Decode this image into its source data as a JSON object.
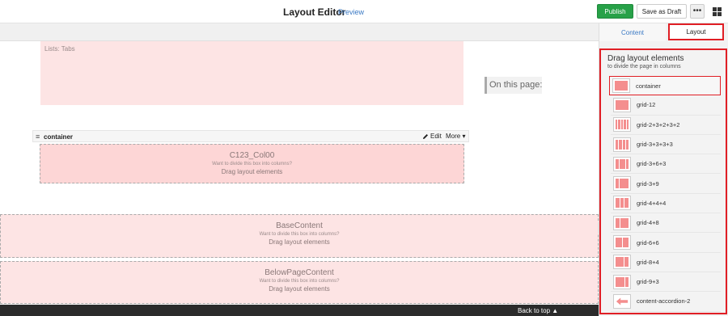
{
  "header": {
    "title": "Layout Editor",
    "preview_label": "Preview",
    "publish_label": "Publish",
    "save_draft_label": "Save as Draft",
    "more_label": "•••"
  },
  "canvas": {
    "lists_tabs_label": "Lists: Tabs",
    "on_this_page": "On this page:",
    "container": {
      "label": "container",
      "edit_label": "Edit",
      "more_label": "More ▾"
    },
    "dropzones": {
      "col00": {
        "title": "C123_Col00",
        "hint": "Want to divide this box into columns?",
        "cta": "Drag layout elements"
      },
      "base": {
        "title": "BaseContent",
        "hint": "Want to divide this box into columns?",
        "cta": "Drag layout elements"
      },
      "below": {
        "title": "BelowPageContent",
        "hint": "Want to divide this box into columns?",
        "cta": "Drag layout elements"
      }
    },
    "back_to_top": "Back to top ▲"
  },
  "sidebar": {
    "tabs": {
      "content": "Content",
      "layout": "Layout"
    },
    "heading": "Drag layout elements",
    "subheading": "to divide the page in columns",
    "items": [
      {
        "label": "container",
        "icon": "container-icon",
        "cols": [
          12
        ]
      },
      {
        "label": "grid-12",
        "icon": "grid-12-icon",
        "cols": [
          12
        ]
      },
      {
        "label": "grid-2+3+2+3+2",
        "icon": "grid-2-3-2-3-2-icon",
        "cols": [
          2,
          3,
          2,
          3,
          2
        ]
      },
      {
        "label": "grid-3+3+3+3",
        "icon": "grid-3-3-3-3-icon",
        "cols": [
          3,
          3,
          3,
          3
        ]
      },
      {
        "label": "grid-3+6+3",
        "icon": "grid-3-6-3-icon",
        "cols": [
          3,
          6,
          3
        ]
      },
      {
        "label": "grid-3+9",
        "icon": "grid-3-9-icon",
        "cols": [
          3,
          9
        ]
      },
      {
        "label": "grid-4+4+4",
        "icon": "grid-4-4-4-icon",
        "cols": [
          4,
          4,
          4
        ]
      },
      {
        "label": "grid-4+8",
        "icon": "grid-4-8-icon",
        "cols": [
          4,
          8
        ]
      },
      {
        "label": "grid-6+6",
        "icon": "grid-6-6-icon",
        "cols": [
          6,
          6
        ]
      },
      {
        "label": "grid-8+4",
        "icon": "grid-8-4-icon",
        "cols": [
          8,
          4
        ]
      },
      {
        "label": "grid-9+3",
        "icon": "grid-9-3-icon",
        "cols": [
          9,
          3
        ]
      },
      {
        "label": "content-accordion-2",
        "icon": "accordion-arrow-icon",
        "cols": []
      }
    ]
  },
  "colors": {
    "accent": "#3a79c4",
    "publish": "#27a148",
    "highlight": "#e01e25",
    "zone": "#fdd6d6"
  }
}
